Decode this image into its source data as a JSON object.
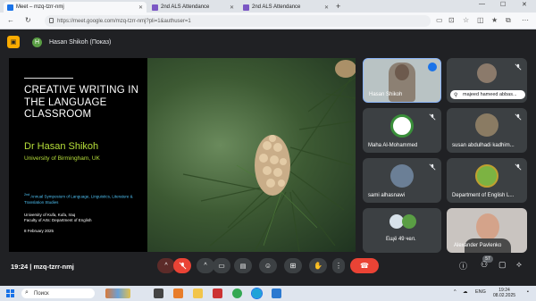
{
  "browser": {
    "tabs": [
      {
        "title": "Meet – mzq-tzrr-nmj",
        "active": true
      },
      {
        "title": "2nd ALS Attendance",
        "active": false
      },
      {
        "title": "2nd ALS Attendance",
        "active": false
      }
    ],
    "new_tab_symbol": "+",
    "url": "https://meet.google.com/mzq-tzrr-nmj?pli=1&authuser=1"
  },
  "meet": {
    "presenter": {
      "initial": "H",
      "name": "Hasan Shikoh (Показ)"
    },
    "slide": {
      "title": "CREATIVE WRITING IN THE LANGUAGE CLASSROOM",
      "author": "Dr Hasan Shikoh",
      "affiliation": "University of Birmingham, UK",
      "symposium_sup": "2nd",
      "symposium": "Annual Symposium of Language, Linguistics, Literature & Translation Studies",
      "institution_line1": "University of Kufa, Kufa, Iraq",
      "institution_line2": "Faculty of Arts: Department of English",
      "date": "8 February 2025"
    },
    "participants": [
      {
        "name": "Hasan Shikoh"
      },
      {
        "name": "majeed hameed abbas..."
      },
      {
        "name": "Maha Al-Mohammed"
      },
      {
        "name": "susan abdulhadi kadhim..."
      },
      {
        "name": "sami alhasnawi"
      },
      {
        "name": "Department of English L..."
      },
      {
        "name": "Ещё 49 чел."
      },
      {
        "name": "Alexander Pavlenko"
      }
    ],
    "meeting_time": "19:24",
    "meeting_code": "mzq-tzrr-nmj",
    "participant_count": "57"
  },
  "taskbar": {
    "search_placeholder": "Поиск",
    "language": "ENG",
    "time": "19:24",
    "date": "08.02.2025"
  },
  "colors": {
    "meet_bg": "#202124",
    "tile_bg": "#3c4043",
    "end_call_red": "#ea4335",
    "slide_author_green": "#b7df3a",
    "slide_symposium_blue": "#4fc3f7",
    "presenting_badge": "#f9ab00"
  }
}
